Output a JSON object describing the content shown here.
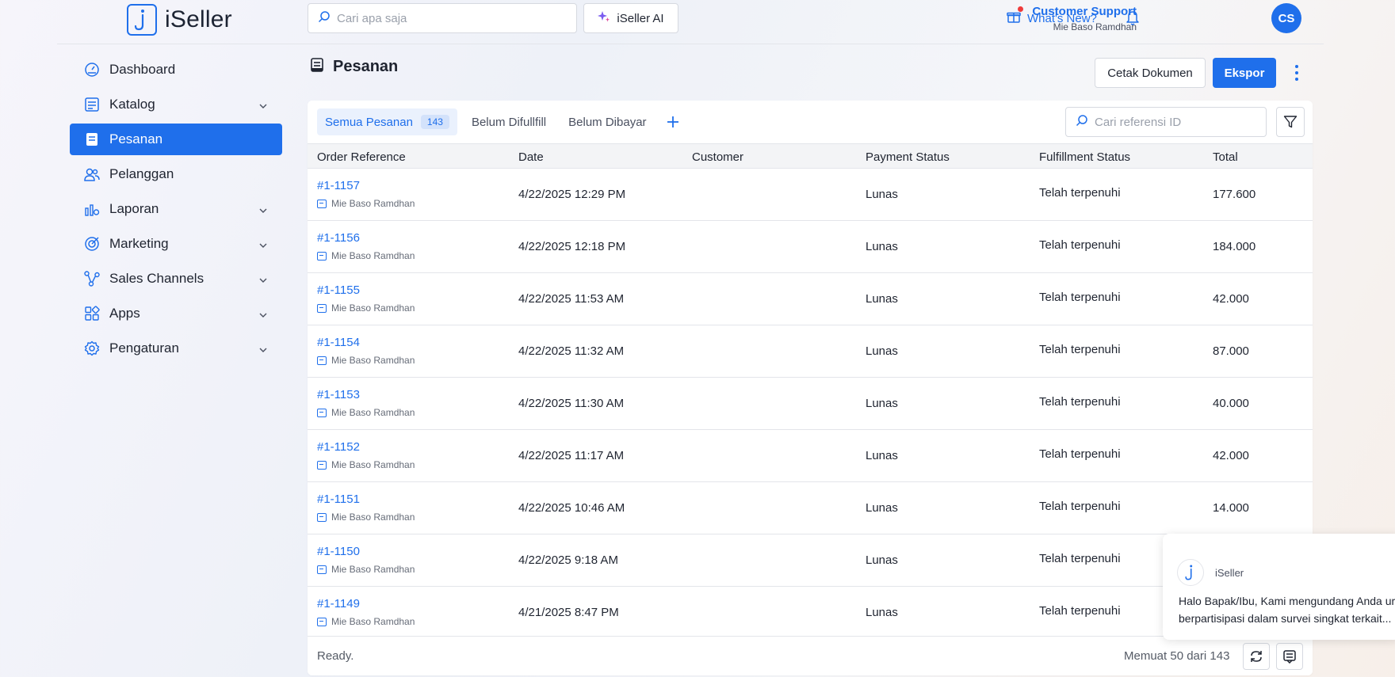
{
  "app": {
    "name": "iSeller"
  },
  "header": {
    "search_placeholder": "Cari apa saja",
    "ai_label": "iSeller AI",
    "whats_new_label": "What's New?",
    "user_name": "Customer Support",
    "user_store": "Mie Baso Ramdhan",
    "user_initials": "CS"
  },
  "sidebar": {
    "items": [
      {
        "label": "Dashboard",
        "icon": "dashboard-icon"
      },
      {
        "label": "Katalog",
        "icon": "catalog-icon"
      },
      {
        "label": "Pesanan",
        "icon": "orders-icon",
        "active": true
      },
      {
        "label": "Pelanggan",
        "icon": "customers-icon"
      },
      {
        "label": "Laporan",
        "icon": "reports-icon"
      },
      {
        "label": "Marketing",
        "icon": "marketing-icon"
      },
      {
        "label": "Sales Channels",
        "icon": "sales-channels-icon"
      },
      {
        "label": "Apps",
        "icon": "apps-icon"
      },
      {
        "label": "Pengaturan",
        "icon": "settings-icon"
      }
    ]
  },
  "page": {
    "title": "Pesanan",
    "print_label": "Cetak Dokumen",
    "export_label": "Ekspor"
  },
  "tabs": [
    {
      "label": "Semua Pesanan",
      "count": "143"
    },
    {
      "label": "Belum Difullfill"
    },
    {
      "label": "Belum Dibayar"
    }
  ],
  "ref_search_placeholder": "Cari referensi ID",
  "table": {
    "columns": [
      "Order Reference",
      "Date",
      "Customer",
      "Payment Status",
      "Fulfillment Status",
      "Total"
    ],
    "rows": [
      {
        "ref": "#1-1157",
        "store": "Mie Baso Ramdhan",
        "date": "4/22/2025 12:29 PM",
        "customer": "",
        "payment": "Lunas",
        "fulfillment": "Telah terpenuhi",
        "total": "177.600"
      },
      {
        "ref": "#1-1156",
        "store": "Mie Baso Ramdhan",
        "date": "4/22/2025 12:18 PM",
        "customer": "",
        "payment": "Lunas",
        "fulfillment": "Telah terpenuhi",
        "total": "184.000"
      },
      {
        "ref": "#1-1155",
        "store": "Mie Baso Ramdhan",
        "date": "4/22/2025 11:53 AM",
        "customer": "",
        "payment": "Lunas",
        "fulfillment": "Telah terpenuhi",
        "total": "42.000"
      },
      {
        "ref": "#1-1154",
        "store": "Mie Baso Ramdhan",
        "date": "4/22/2025 11:32 AM",
        "customer": "",
        "payment": "Lunas",
        "fulfillment": "Telah terpenuhi",
        "total": "87.000"
      },
      {
        "ref": "#1-1153",
        "store": "Mie Baso Ramdhan",
        "date": "4/22/2025 11:30 AM",
        "customer": "",
        "payment": "Lunas",
        "fulfillment": "Telah terpenuhi",
        "total": "40.000"
      },
      {
        "ref": "#1-1152",
        "store": "Mie Baso Ramdhan",
        "date": "4/22/2025 11:17 AM",
        "customer": "",
        "payment": "Lunas",
        "fulfillment": "Telah terpenuhi",
        "total": "42.000"
      },
      {
        "ref": "#1-1151",
        "store": "Mie Baso Ramdhan",
        "date": "4/22/2025 10:46 AM",
        "customer": "",
        "payment": "Lunas",
        "fulfillment": "Telah terpenuhi",
        "total": "14.000"
      },
      {
        "ref": "#1-1150",
        "store": "Mie Baso Ramdhan",
        "date": "4/22/2025 9:18 AM",
        "customer": "",
        "payment": "Lunas",
        "fulfillment": "Telah terpenuhi",
        "total": ""
      },
      {
        "ref": "#1-1149",
        "store": "Mie Baso Ramdhan",
        "date": "4/21/2025 8:47 PM",
        "customer": "",
        "payment": "Lunas",
        "fulfillment": "Telah terpenuhi",
        "total": ""
      }
    ]
  },
  "footer": {
    "status": "Ready.",
    "loaded": "Memuat 50 dari 143"
  },
  "chat_popup": {
    "sender": "iSeller",
    "line1": "Halo Bapak/Ibu, Kami mengundang Anda ur",
    "line2": "berpartisipasi dalam survei singkat terkait..."
  },
  "colors": {
    "accent": "#1f6feb",
    "notification_dot": "#ef3b3b"
  }
}
